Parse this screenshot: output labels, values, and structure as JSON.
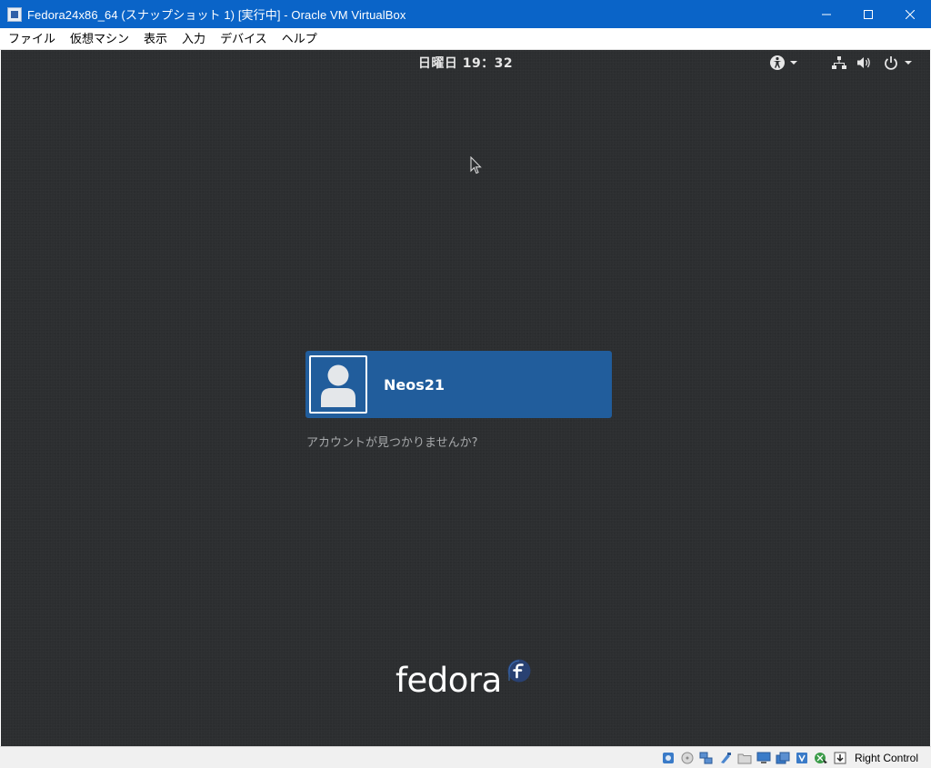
{
  "window": {
    "title": "Fedora24x86_64 (スナップショット 1) [実行中] - Oracle VM VirtualBox",
    "accent_color": "#0a64c8"
  },
  "menubar": {
    "items": [
      {
        "label": "ファイル"
      },
      {
        "label": "仮想マシン"
      },
      {
        "label": "表示"
      },
      {
        "label": "入力"
      },
      {
        "label": "デバイス"
      },
      {
        "label": "ヘルプ"
      }
    ]
  },
  "gnome": {
    "clock": "日曜日 19：32",
    "background_color": "#2c2e30",
    "tray_icons": [
      "accessibility-icon",
      "network-icon",
      "volume-icon",
      "power-icon"
    ]
  },
  "login": {
    "user_name": "Neos21",
    "user_button_color": "#215d9c",
    "not_listed_link": "アカウントが見つかりませんか?",
    "logo_text": "fedora"
  },
  "statusbar": {
    "icons": [
      "hard-disk-icon",
      "optical-drive-icon",
      "network-adapter-icon",
      "usb-icon",
      "shared-folders-icon",
      "display-icon",
      "video-capture-icon",
      "virtualization-icon",
      "mouse-integration-icon",
      "keyboard-capture-icon"
    ],
    "host_key": "Right Control"
  }
}
